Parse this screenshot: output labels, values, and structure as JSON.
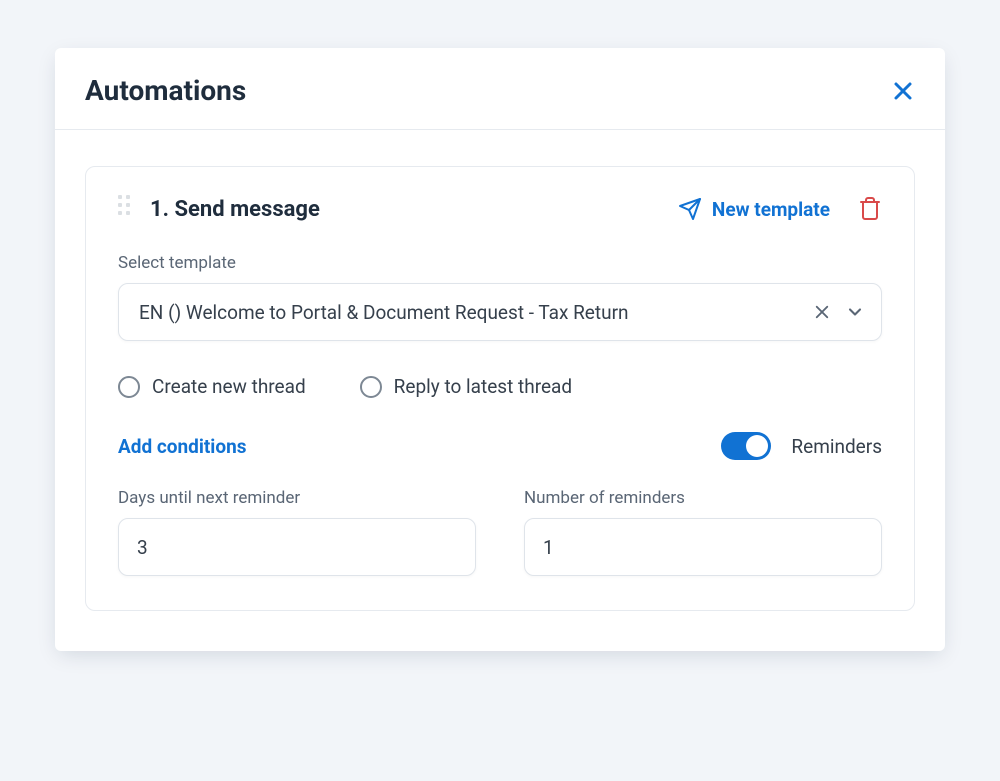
{
  "modal": {
    "title": "Automations"
  },
  "card": {
    "title": "1. Send message",
    "new_template_label": "New template",
    "select_label": "Select template",
    "select_value": "EN () Welcome to Portal & Document Request - Tax Return",
    "radio_create": "Create new thread",
    "radio_reply": "Reply to latest thread",
    "add_conditions": "Add conditions",
    "reminders_label": "Reminders",
    "days_label": "Days until next reminder",
    "days_value": "3",
    "count_label": "Number of reminders",
    "count_value": "1"
  }
}
